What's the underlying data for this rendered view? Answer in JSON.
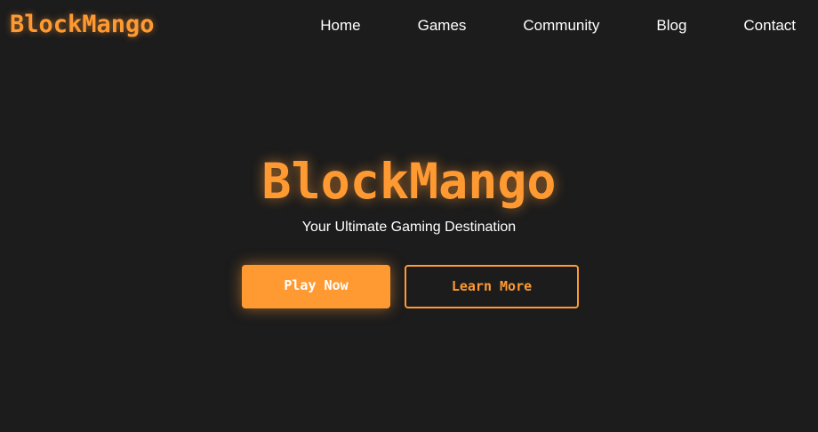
{
  "nav": {
    "logo": "BlockMango",
    "links": [
      "Home",
      "Games",
      "Community",
      "Blog",
      "Contact"
    ]
  },
  "hero": {
    "title": "BlockMango",
    "subtitle": "Your Ultimate Gaming Destination",
    "primary_button": "Play Now",
    "secondary_button": "Learn More"
  },
  "colors": {
    "accent": "#ff9a33",
    "background": "#1c1c1c",
    "text": "#ffffff"
  }
}
